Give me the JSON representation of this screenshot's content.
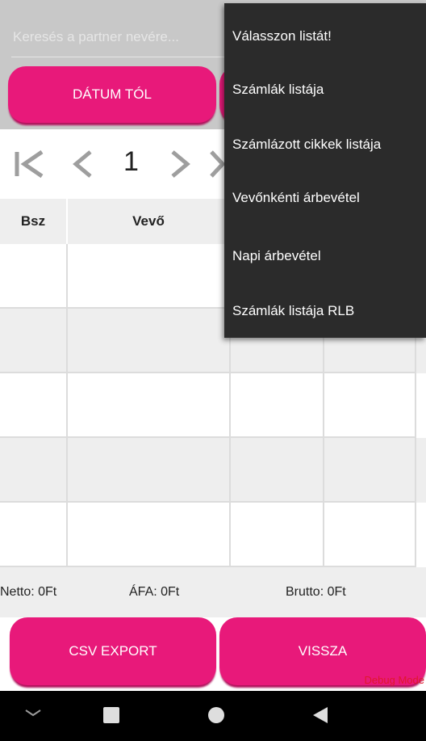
{
  "search": {
    "placeholder": "Keresés a partner nevére..."
  },
  "buttons": {
    "date_from": "DÁTUM TÓL",
    "date_to": "",
    "csv_export": "CSV EXPORT",
    "back": "VISSZA"
  },
  "pager": {
    "first": "|<",
    "prev": "<",
    "page": "1",
    "next": ">",
    "last": ">|"
  },
  "table": {
    "headers": [
      "Bsz",
      "Vevő"
    ]
  },
  "totals": {
    "netto": "Netto: 0Ft",
    "afa": "ÁFA: 0Ft",
    "brutto": "Brutto: 0Ft"
  },
  "debug_label": "Debug Mode",
  "menu": {
    "items": [
      "Válasszon listát!",
      "Számlák listája",
      "Számlázott cikkek listája",
      "Vevőnkénti árbevétel",
      "Napi árbevétel",
      "Számlák listája RLB"
    ]
  },
  "colors": {
    "accent": "#e8197a",
    "menu_bg": "#2b2b2b",
    "debug": "#e0182c"
  }
}
